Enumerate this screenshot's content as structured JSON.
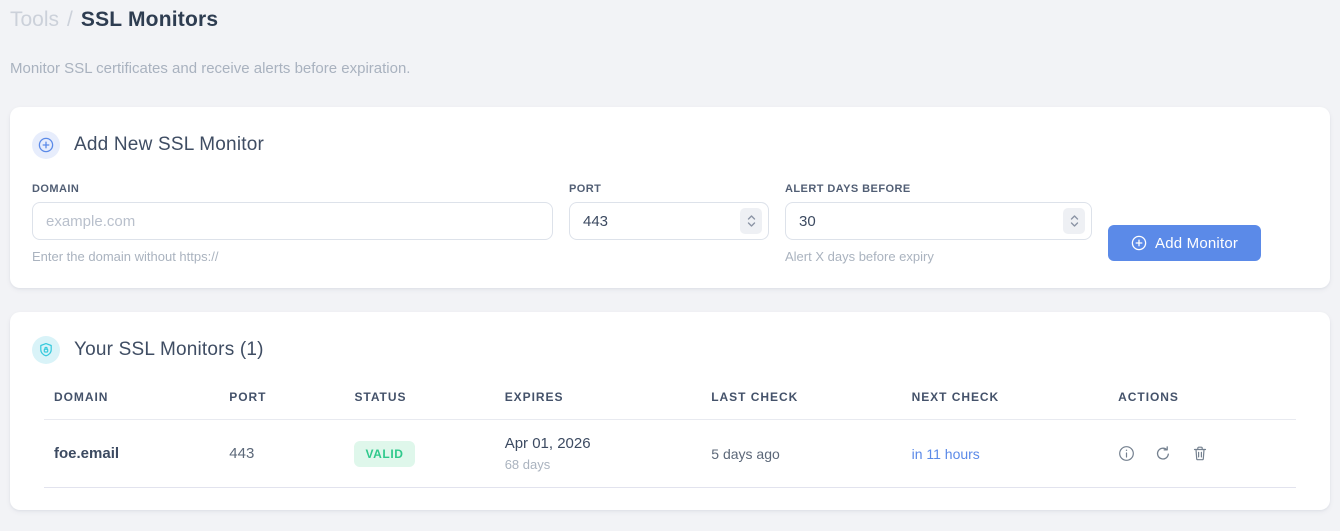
{
  "page": {
    "breadcrumb": {
      "section": "Tools",
      "separator": "/",
      "current": "SSL Monitors"
    },
    "subtitle": "Monitor SSL certificates and receive alerts before expiration."
  },
  "add_monitor_card": {
    "title": "Add New SSL Monitor",
    "fields": {
      "domain": {
        "label": "DOMAIN",
        "placeholder": "example.com",
        "value": "",
        "helper": "Enter the domain without https://"
      },
      "port": {
        "label": "PORT",
        "value": "443"
      },
      "alert_days": {
        "label": "ALERT DAYS BEFORE",
        "value": "30",
        "helper": "Alert X days before expiry"
      }
    },
    "submit_label": "Add Monitor"
  },
  "monitors_card": {
    "title": "Your SSL Monitors (1)",
    "table": {
      "headers": [
        "DOMAIN",
        "PORT",
        "STATUS",
        "EXPIRES",
        "LAST CHECK",
        "NEXT CHECK",
        "ACTIONS"
      ],
      "rows": [
        {
          "domain": "foe.email",
          "port": "443",
          "status": "VALID",
          "expires_date": "Apr 01, 2026",
          "expires_days": "68 days",
          "last_check": "5 days ago",
          "next_check": "in 11 hours"
        }
      ]
    }
  },
  "colors": {
    "accent_blue": "#5b8ae8",
    "success_text": "#2fc98c",
    "success_bg": "#dff7eb",
    "shield_cyan": "#35c9dc",
    "page_bg": "#f2f3f6"
  }
}
